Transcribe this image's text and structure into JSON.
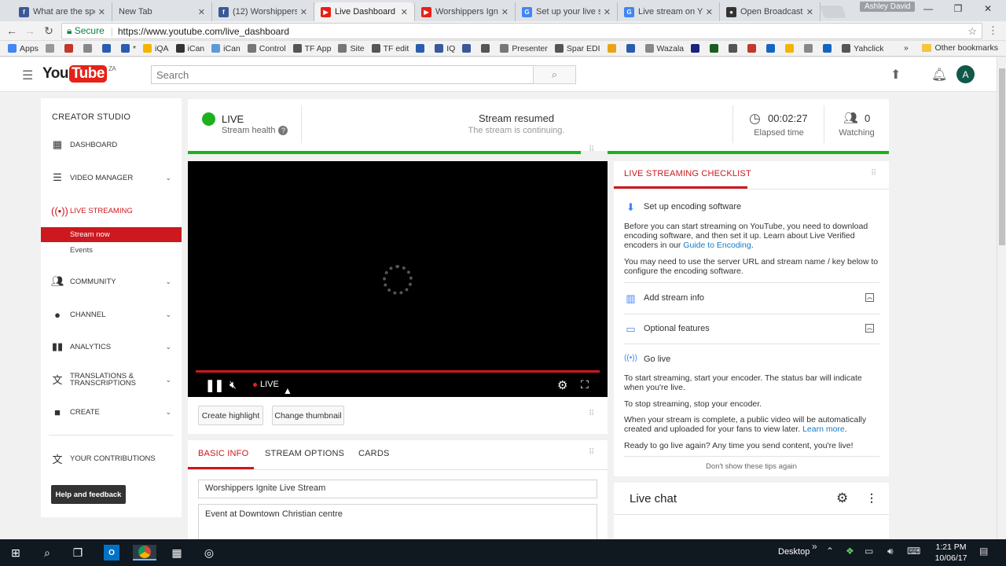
{
  "browser": {
    "tabs": [
      {
        "label": "What are the spe",
        "favicon_color": "#3b5998",
        "favicon": "f",
        "active": false
      },
      {
        "label": "New Tab",
        "favicon_color": "#dee1e6",
        "favicon": "",
        "active": false
      },
      {
        "label": "(12) Worshippers",
        "favicon_color": "#3b5998",
        "favicon": "f",
        "active": false
      },
      {
        "label": "Live Dashboard",
        "favicon_color": "#e62117",
        "favicon": "▶",
        "active": true
      },
      {
        "label": "Worshippers Ignit",
        "favicon_color": "#e62117",
        "favicon": "▶",
        "active": false
      },
      {
        "label": "Set up your live st",
        "favicon_color": "#4285f4",
        "favicon": "G",
        "active": false
      },
      {
        "label": "Live stream on Yo",
        "favicon_color": "#4285f4",
        "favicon": "G",
        "active": false
      },
      {
        "label": "Open Broadcaster",
        "favicon_color": "#333333",
        "favicon": "●",
        "active": false
      }
    ],
    "profile_name": "Ashley David",
    "window_controls": {
      "minimize": "—",
      "restore": "❐",
      "close": "✕"
    },
    "secure_label": "Secure",
    "url": "https://www.youtube.com/live_dashboard",
    "bookmarks": [
      {
        "label": "Apps",
        "color": "#4285f4"
      },
      {
        "label": "",
        "color": "#999999"
      },
      {
        "label": "",
        "color": "#c0392b"
      },
      {
        "label": "",
        "color": "#888888"
      },
      {
        "label": "",
        "color": "#2a5db0"
      },
      {
        "label": "*",
        "color": "#2a5db0"
      },
      {
        "label": "iQA",
        "color": "#f4b400"
      },
      {
        "label": "iCan",
        "color": "#333333"
      },
      {
        "label": "iCan",
        "color": "#5b9bd5"
      },
      {
        "label": "Control",
        "color": "#777777"
      },
      {
        "label": "TF App",
        "color": "#555555"
      },
      {
        "label": "Site",
        "color": "#777777"
      },
      {
        "label": "TF edit",
        "color": "#555555"
      },
      {
        "label": "",
        "color": "#2a5db0"
      },
      {
        "label": "IQ",
        "color": "#3b5998"
      },
      {
        "label": "",
        "color": "#3b5998"
      },
      {
        "label": "",
        "color": "#555555"
      },
      {
        "label": "Presenter",
        "color": "#777777"
      },
      {
        "label": "Spar EDI",
        "color": "#555555"
      },
      {
        "label": "",
        "color": "#e8a317"
      },
      {
        "label": "",
        "color": "#2a5db0"
      },
      {
        "label": "Wazala",
        "color": "#888888"
      },
      {
        "label": "",
        "color": "#1a237e"
      },
      {
        "label": "",
        "color": "#1b5e20"
      },
      {
        "label": "",
        "color": "#555555"
      },
      {
        "label": "",
        "color": "#c0392b"
      },
      {
        "label": "",
        "color": "#1565c0"
      },
      {
        "label": "",
        "color": "#f4b400"
      },
      {
        "label": "",
        "color": "#888888"
      },
      {
        "label": "",
        "color": "#1565c0"
      },
      {
        "label": "Yahclick",
        "color": "#555555"
      }
    ],
    "bookmarks_overflow": "»",
    "other_bookmarks": "Other bookmarks"
  },
  "youtube": {
    "logo_you": "You",
    "logo_tube": "Tube",
    "logo_country": "ZA",
    "search_placeholder": "Search",
    "avatar_initial": "A"
  },
  "sidebar": {
    "title": "CREATOR STUDIO",
    "items": [
      {
        "label": "DASHBOARD",
        "icon": "dashboard-icon"
      },
      {
        "label": "VIDEO MANAGER",
        "icon": "video-manager-icon"
      },
      {
        "label": "LIVE STREAMING",
        "icon": "live-streaming-icon"
      },
      {
        "label": "COMMUNITY",
        "icon": "community-icon"
      },
      {
        "label": "CHANNEL",
        "icon": "channel-icon"
      },
      {
        "label": "ANALYTICS",
        "icon": "analytics-icon"
      },
      {
        "label": "TRANSLATIONS &",
        "label2": "TRANSCRIPTIONS",
        "icon": "translations-icon"
      },
      {
        "label": "CREATE",
        "icon": "create-icon"
      },
      {
        "label": "YOUR CONTRIBUTIONS",
        "icon": "contributions-icon"
      }
    ],
    "live_sub": [
      "Stream now",
      "Events"
    ],
    "help_button": "Help and feedback",
    "live_color": "#cc181e"
  },
  "status": {
    "live": "LIVE",
    "health": "Stream health",
    "health_help": "?",
    "resumed": "Stream resumed",
    "resumed_sub": "The stream is continuing.",
    "elapsed": "00:02:27",
    "elapsed_label": "Elapsed time",
    "watching_count": "0",
    "watching_label": "Watching",
    "health_color": "#1db11d"
  },
  "player": {
    "live_badge": "LIVE"
  },
  "video_buttons": {
    "highlight": "Create highlight",
    "thumbnail": "Change thumbnail"
  },
  "info": {
    "tabs": [
      "BASIC INFO",
      "STREAM OPTIONS",
      "CARDS"
    ],
    "title_value": "Worshippers Ignite Live Stream",
    "description_value": "Event at Downtown Christian centre"
  },
  "checklist": {
    "title": "LIVE STREAMING CHECKLIST",
    "step1": "Set up encoding software",
    "para1a": "Before you can start streaming on YouTube, you need to download encoding software, and then set it up. Learn about Live Verified encoders in our ",
    "para1_link": "Guide to Encoding",
    "para1b": ".",
    "para2": "You may need to use the server URL and stream name / key below to configure the encoding software.",
    "step2": "Add stream info",
    "step3": "Optional features",
    "step4": "Go live",
    "para3": "To start streaming, start your encoder. The status bar will indicate when you're live.",
    "para4": "To stop streaming, stop your encoder.",
    "para5a": "When your stream is complete, a public video will be automatically created and uploaded for your fans to view later. ",
    "para5_link": "Learn more",
    "para5b": ".",
    "para6": "Ready to go live again? Any time you send content, you're live!",
    "dismiss": "Don't show these tips again"
  },
  "livechat": {
    "title": "Live chat"
  },
  "taskbar": {
    "desktop": "Desktop",
    "time": "1:21 PM",
    "date": "10/06/17",
    "tray_overflow": "»"
  }
}
